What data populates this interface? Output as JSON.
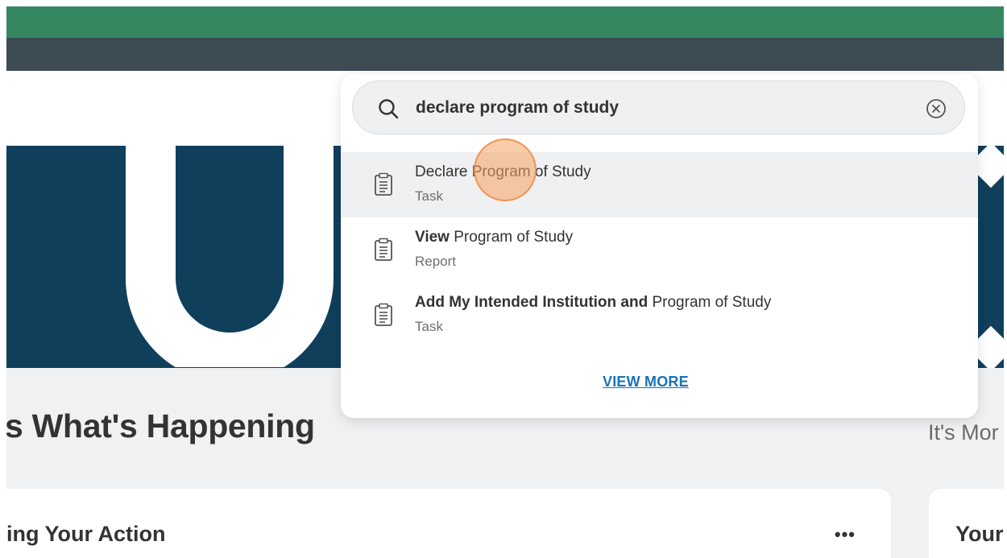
{
  "colors": {
    "header_green": "#358760",
    "header_dark": "#3d4b55",
    "banner_navy": "#103f5c",
    "link_blue": "#1874b8",
    "click_highlight": "#f7a360"
  },
  "search": {
    "value": "declare program of study",
    "search_icon": "search-icon",
    "clear_icon": "clear-circle-x-icon"
  },
  "results": [
    {
      "icon": "clipboard-icon",
      "title_bold": "",
      "title_rest_a": "Declare Program of Study",
      "title_mid": "",
      "title_rest_b": "",
      "type": "Task"
    },
    {
      "icon": "clipboard-icon",
      "title_bold": "View",
      "title_rest_a": " Program of Study",
      "title_mid": "",
      "title_rest_b": "",
      "type": "Report"
    },
    {
      "icon": "clipboard-icon",
      "title_bold": "Add My Intended Institution",
      "title_rest_a": " ",
      "title_mid": "and",
      "title_rest_b": " Program of Study",
      "type": "Task"
    }
  ],
  "view_more_label": "VIEW MORE",
  "page": {
    "happening_title": "s What's Happening",
    "more_text": "It's Mor",
    "action_card_title": "ing Your Action",
    "action_card_menu": "•••",
    "your_card_title": "Your"
  }
}
